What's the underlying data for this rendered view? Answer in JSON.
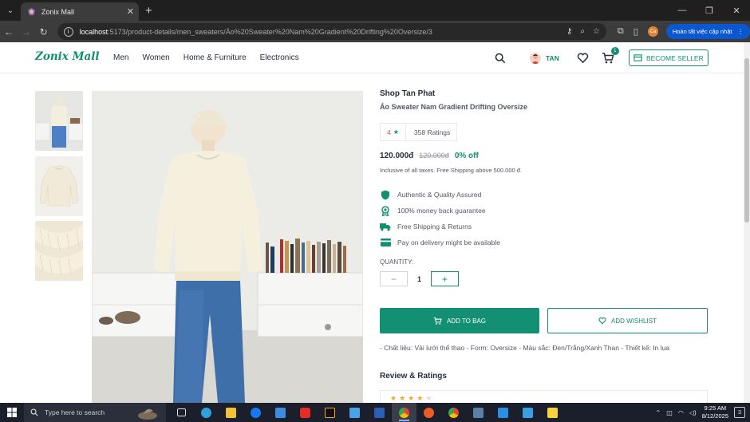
{
  "browser": {
    "tab_title": "Zonix Mall",
    "tab_close": "✕",
    "new_tab": "+",
    "url_host": "localhost",
    "url_path": ":5173/product-details/men_sweaters/Áo%20Sweater%20Nam%20Gradient%20Drifting%20Oversize/3",
    "profile_initials": "Ca",
    "update_label": "Hoàn tất việc cập nhật"
  },
  "header": {
    "logo": "Zonix Mall",
    "nav": [
      "Men",
      "Women",
      "Home & Furniture",
      "Electronics"
    ],
    "user_name": "TAN",
    "cart_count": "1",
    "seller_label": "BECOME SELLER"
  },
  "product": {
    "shop_name": "Shop Tan Phat",
    "name": "Áo Sweater Nam Gradient Drifting Oversize",
    "rating": "4",
    "ratings_count": "358 Ratings",
    "price": "120.000đ",
    "mrp": "120.000đ",
    "discount": "0% off",
    "tax_note": "Inclusive of all taxes. Free Shipping above 500.000 đ.",
    "features": [
      {
        "icon": "shield-icon",
        "label": "Authentic & Quality Assured"
      },
      {
        "icon": "badge-icon",
        "label": "100% money back guarantee"
      },
      {
        "icon": "truck-icon",
        "label": "Free Shipping & Returns"
      },
      {
        "icon": "card-icon",
        "label": "Pay on delivery might be available"
      }
    ],
    "quantity_label": "QUANTITY:",
    "quantity": "1",
    "add_to_bag": "ADD TO BAG",
    "add_wishlist": "ADD WISHLIST",
    "description": "- Chất liệu: Vải lưới thể thao - Form: Oversize - Màu sắc: Đen/Trắng/Xanh Than - Thiết kế: In lụa",
    "review_title": "Review & Ratings"
  },
  "taskbar": {
    "search_placeholder": "Type here to search",
    "time": "9:25 AM",
    "date": "8/12/2025",
    "notifications": "3"
  },
  "colors": {
    "brand": "#118f6f",
    "add_to_bag_bg": "#138f74",
    "browser_dark": "#1f1f1f",
    "taskbar": "#1b1e2b"
  }
}
